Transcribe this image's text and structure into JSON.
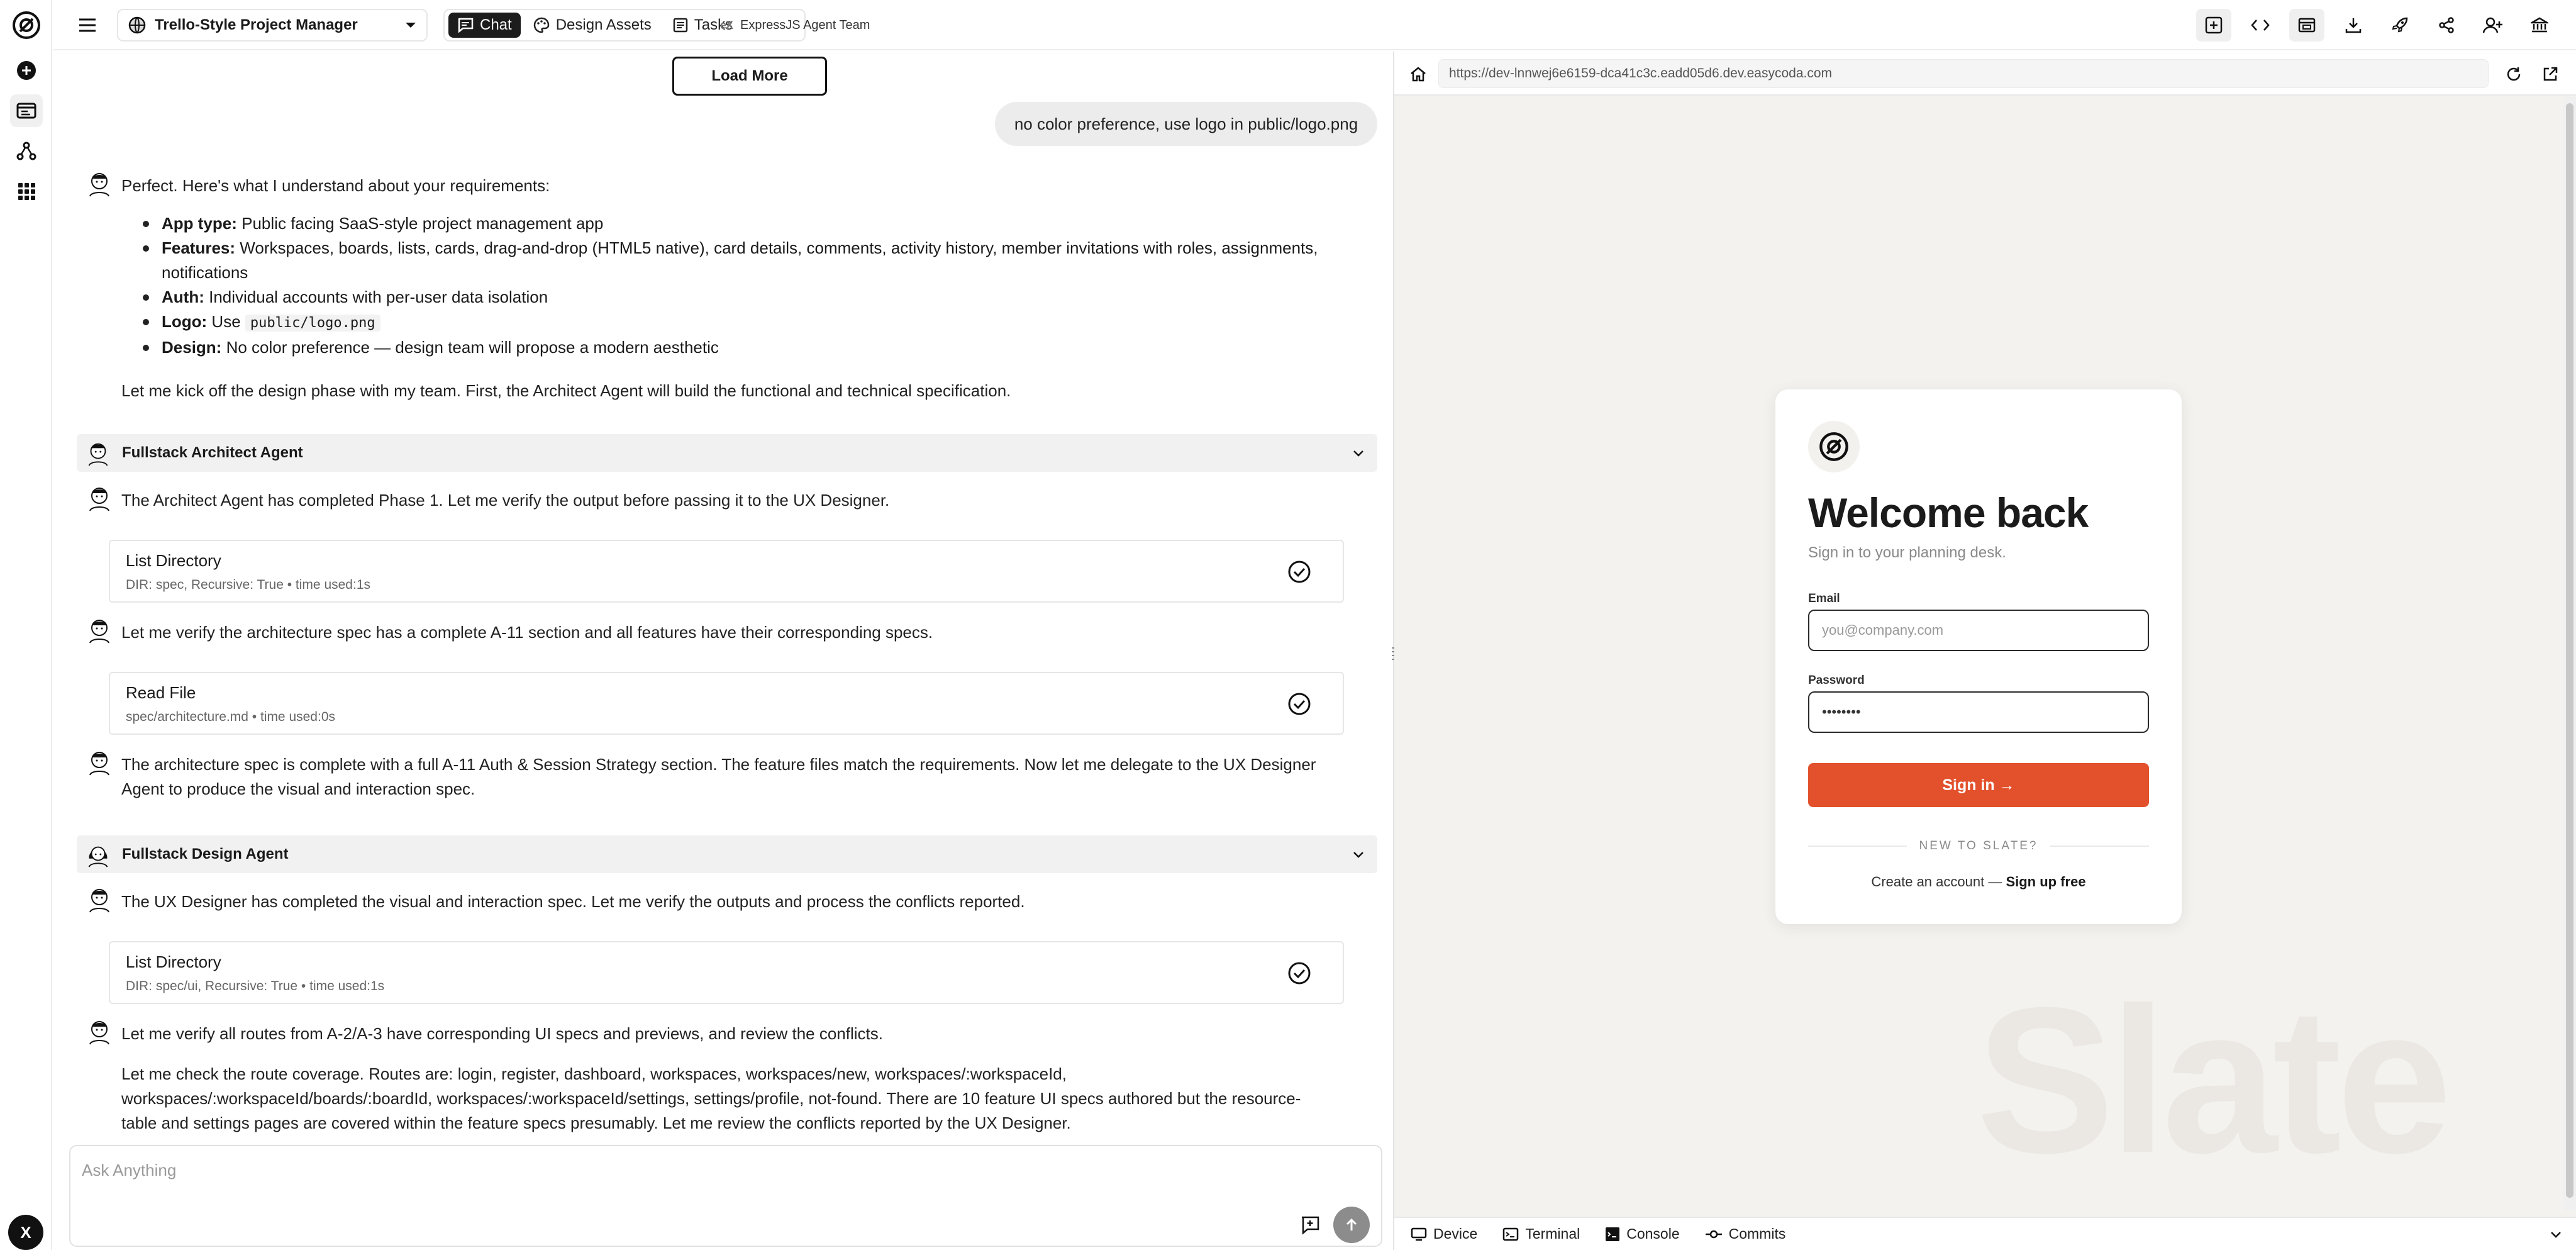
{
  "rail": {
    "icons": [
      "logo-icon",
      "new-icon",
      "projects-icon",
      "network-icon",
      "apps-icon"
    ],
    "user_initial": "X"
  },
  "topbar": {
    "project_name": "Trello-Style Project Manager",
    "tabs": [
      {
        "label": "Chat",
        "icon": "chat-icon",
        "active": true
      },
      {
        "label": "Design Assets",
        "icon": "palette-icon",
        "active": false
      },
      {
        "label": "Tasks",
        "icon": "tasks-icon",
        "active": false
      }
    ],
    "team_badge": "eX",
    "team_label": "ExpressJS Agent Team",
    "actions": [
      "add-panel-icon",
      "code-icon",
      "preview-icon",
      "download-icon",
      "deploy-icon",
      "share-icon",
      "add-user-icon",
      "bank-icon"
    ]
  },
  "chat": {
    "load_more": "Load More",
    "user_message": "no color preference, use logo in public/logo.png",
    "intro": "Perfect. Here's what I understand about your requirements:",
    "requirements": [
      {
        "label": "App type:",
        "text": "Public facing SaaS-style project management app"
      },
      {
        "label": "Features:",
        "text": "Workspaces, boards, lists, cards, drag-and-drop (HTML5 native), card details, comments, activity history, member invitations with roles, assignments,"
      },
      {
        "label": "",
        "text": "notifications"
      },
      {
        "label": "Auth:",
        "text": "Individual accounts with per-user data isolation"
      },
      {
        "label": "Logo:",
        "text": "Use ",
        "code": "public/logo.png"
      },
      {
        "label": "Design:",
        "text": "No color preference — design team will propose a modern aesthetic"
      }
    ],
    "kickoff": "Let me kick off the design phase with my team. First, the Architect Agent will build the functional and technical specification.",
    "agent1": "Fullstack Architect Agent",
    "m1": "The Architect Agent has completed Phase 1. Let me verify the output before passing it to the UX Designer.",
    "tool1_title": "List Directory",
    "tool1_meta": "DIR: spec, Recursive: True • time used:1s",
    "m2": "Let me verify the architecture spec has a complete A-11 section and all features have their corresponding specs.",
    "tool2_title": "Read File",
    "tool2_meta": "spec/architecture.md • time used:0s",
    "m3a": "The architecture spec is complete with a full A-11 Auth & Session Strategy section. The feature files match the requirements. Now let me delegate to the UX Designer",
    "m3b": "Agent to produce the visual and interaction spec.",
    "agent2": "Fullstack Design Agent",
    "m4": "The UX Designer has completed the visual and interaction spec. Let me verify the outputs and process the conflicts reported.",
    "tool3_title": "List Directory",
    "tool3_meta": "DIR: spec/ui, Recursive: True • time used:1s",
    "m5": "Let me verify all routes from A-2/A-3 have corresponding UI specs and previews, and review the conflicts.",
    "m6a": "Let me check the route coverage. Routes are: login, register, dashboard, workspaces, workspaces/new, workspaces/:workspaceId,",
    "m6b": "workspaces/:workspaceId/boards/:boardId, workspaces/:workspaceId/settings, settings/profile, not-found. There are 10 feature UI specs authored but the resource-",
    "m6c": "table and settings pages are covered within the feature specs presumably. Let me review the conflicts reported by the UX Designer."
  },
  "input": {
    "placeholder": "Ask Anything"
  },
  "preview": {
    "url": "https://dev-lnnwej6e6159-dca41c3c.eadd05d6.dev.easycoda.com",
    "watermark": "Slate",
    "login": {
      "title": "Welcome back",
      "subtitle": "Sign in to your planning desk.",
      "email_label": "Email",
      "email_placeholder": "you@company.com",
      "password_label": "Password",
      "password_value": "••••••••",
      "signin_label": "Sign in →",
      "divider": "NEW TO SLATE?",
      "create_text": "Create an account — ",
      "signup_link": "Sign up free"
    },
    "bottom_tabs": [
      {
        "label": "Device",
        "icon": "device-icon"
      },
      {
        "label": "Terminal",
        "icon": "terminal-icon"
      },
      {
        "label": "Console",
        "icon": "console-icon"
      },
      {
        "label": "Commits",
        "icon": "commits-icon"
      }
    ]
  },
  "colors": {
    "accent": "#e2512c",
    "dark": "#1c1c1c",
    "preview_bg": "#f4f2ee"
  }
}
